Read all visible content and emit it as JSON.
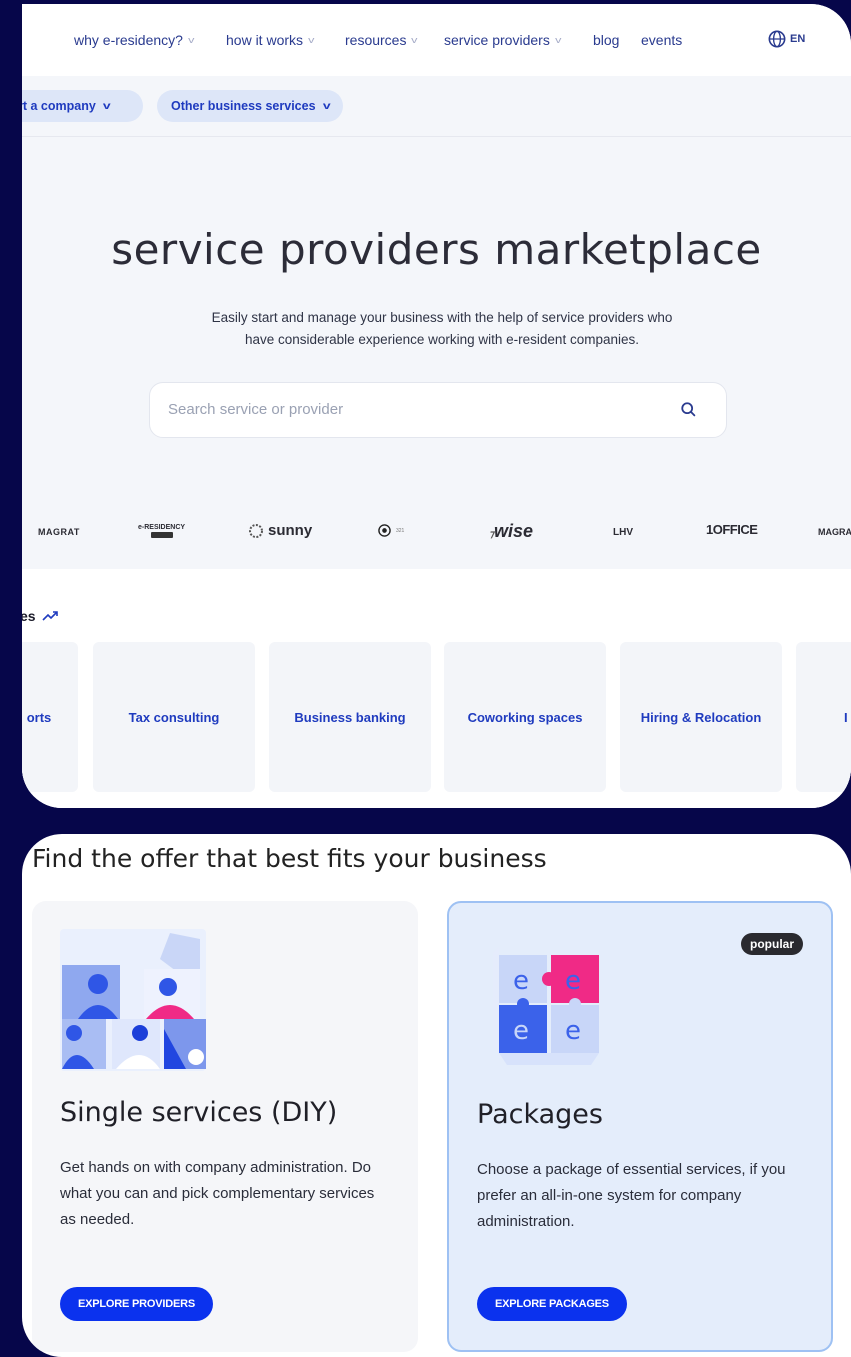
{
  "nav": {
    "items": [
      {
        "label": "why e-residency?",
        "has_dropdown": true
      },
      {
        "label": "how it works",
        "has_dropdown": true
      },
      {
        "label": "resources",
        "has_dropdown": true
      },
      {
        "label": "service providers",
        "has_dropdown": true
      },
      {
        "label": "blog",
        "has_dropdown": false
      },
      {
        "label": "events",
        "has_dropdown": false
      }
    ],
    "language": "EN"
  },
  "subnav": {
    "start_company": "rt a company",
    "other_services": "Other business services"
  },
  "hero": {
    "title": "service providers marketplace",
    "subtitle_line1": "Easily start and manage your business with the help of service providers who",
    "subtitle_line2": "have considerable experience working with e-resident companies.",
    "search_placeholder": "Search service or provider"
  },
  "logos": [
    "MAGRAT",
    "e-RESIDENCY",
    "sunny",
    "321",
    "wise",
    "LHV",
    "1OFFICE",
    "MAGRAT"
  ],
  "categories": {
    "title": "es",
    "items": [
      "orts",
      "Tax consulting",
      "Business banking",
      "Coworking spaces",
      "Hiring & Relocation",
      "I"
    ]
  },
  "offers": {
    "title": "Find the offer that best fits your business",
    "single": {
      "title": "Single services (DIY)",
      "text": "Get hands on with company administration. Do what you can and pick complementary services as needed.",
      "button": "EXPLORE PROVIDERS"
    },
    "packages": {
      "badge": "popular",
      "title": "Packages",
      "text": "Choose a package of essential services, if you prefer an all-in-one system for company administration.",
      "button": "EXPLORE PACKAGES"
    }
  },
  "colors": {
    "background": "#06064a",
    "accent": "#0b32ee",
    "link": "#1f3bbf",
    "pink": "#f02a86"
  }
}
